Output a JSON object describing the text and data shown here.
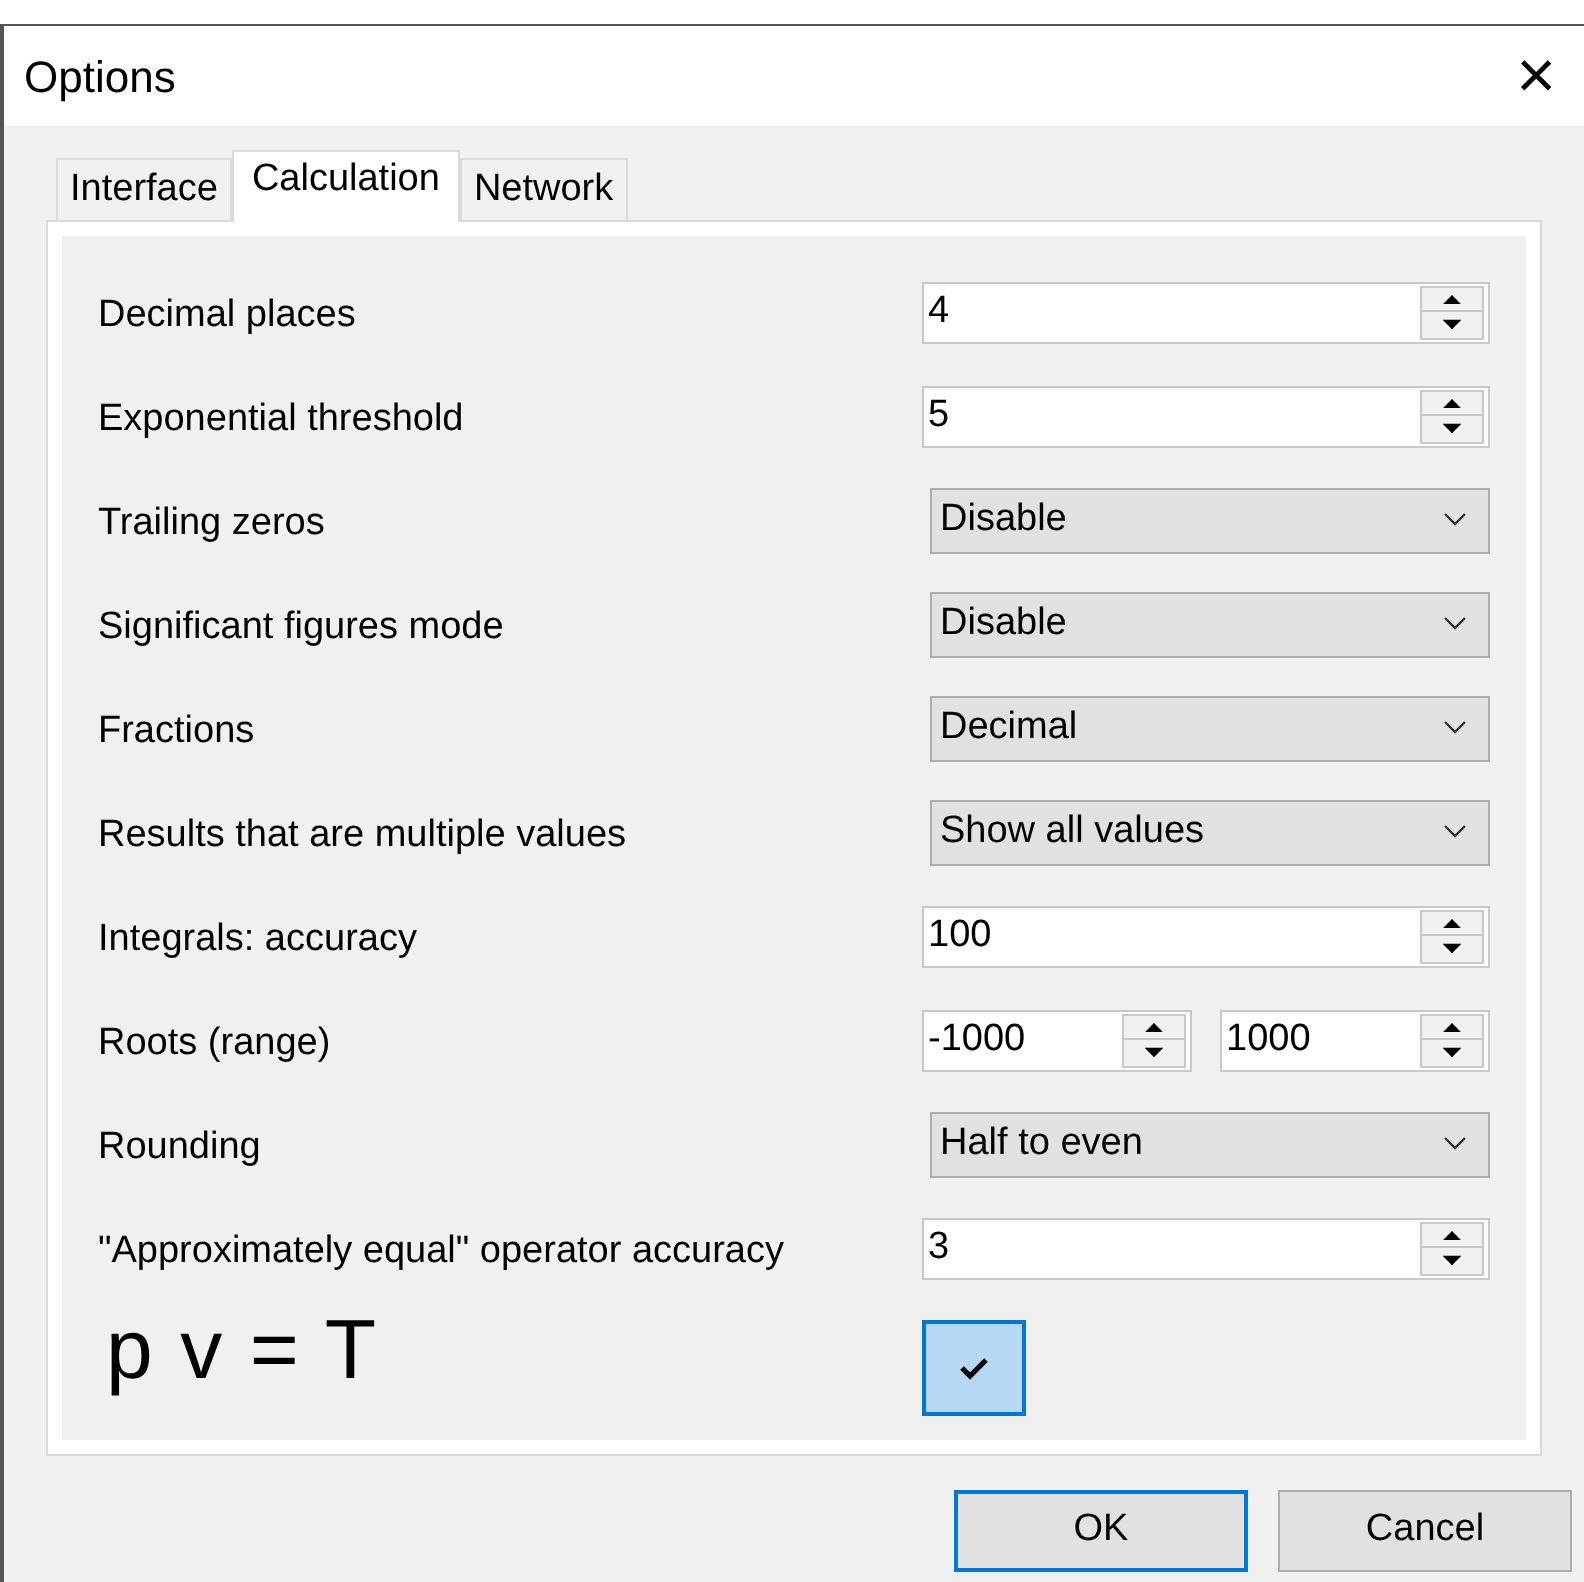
{
  "window": {
    "title": "Options",
    "close": "×"
  },
  "tabs": [
    {
      "label": "Interface",
      "selected": false
    },
    {
      "label": "Calculation",
      "selected": true
    },
    {
      "label": "Network",
      "selected": false
    }
  ],
  "settings": [
    {
      "kind": "spin",
      "label": "Decimal places",
      "value": "4"
    },
    {
      "kind": "spin",
      "label": "Exponential threshold",
      "value": "5"
    },
    {
      "kind": "select",
      "label": "Trailing zeros",
      "value": "Disable"
    },
    {
      "kind": "select",
      "label": "Significant figures mode",
      "value": "Disable"
    },
    {
      "kind": "select",
      "label": "Fractions",
      "value": "Decimal"
    },
    {
      "kind": "select",
      "label": "Results that are multiple values",
      "value": "Show all values"
    },
    {
      "kind": "spin",
      "label": "Integrals: accuracy",
      "value": "100"
    },
    {
      "kind": "range",
      "label": "Roots (range)",
      "value": "-1000",
      "value2": "1000"
    },
    {
      "kind": "select",
      "label": "Rounding",
      "value": "Half to even"
    },
    {
      "kind": "spin",
      "label": "\"Approximately equal\" operator accuracy",
      "value": "3"
    },
    {
      "kind": "checkbox",
      "label": "p v = T",
      "checked": true
    }
  ],
  "buttons": [
    {
      "label": "OK",
      "default": true
    },
    {
      "label": "Cancel",
      "default": false
    }
  ]
}
